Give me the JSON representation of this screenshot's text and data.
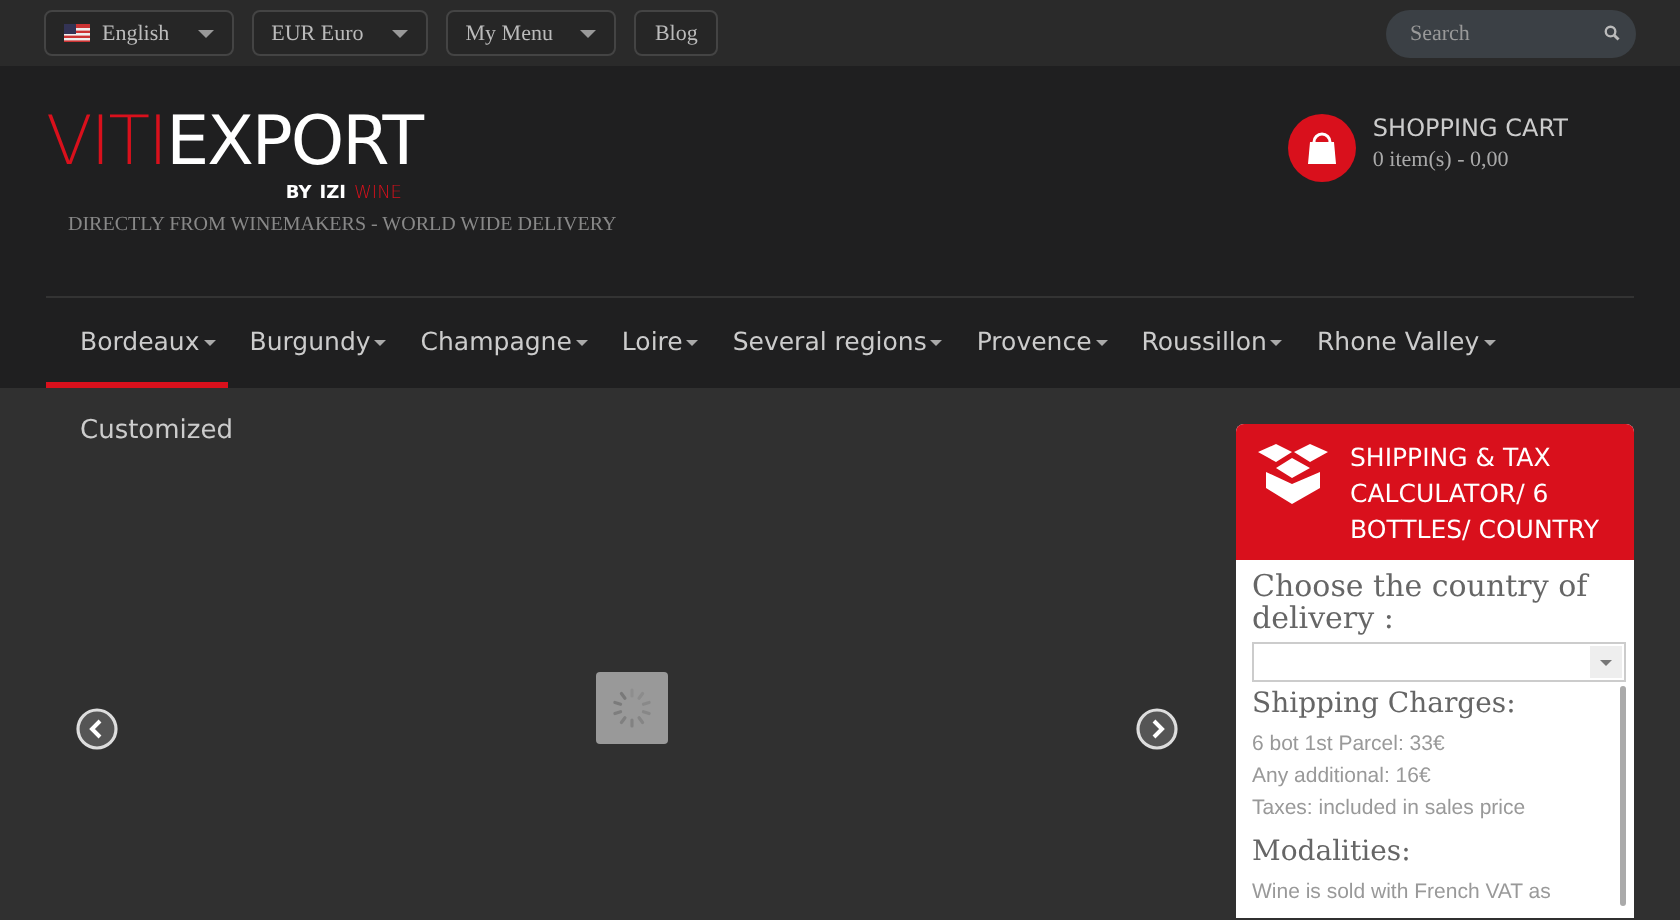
{
  "top_bar": {
    "items": [
      {
        "kind": "flag-dropdown",
        "label": "English"
      },
      {
        "kind": "dropdown",
        "label": "EUR Euro"
      },
      {
        "kind": "dropdown",
        "label": "My Menu"
      },
      {
        "kind": "link",
        "label": "Blog"
      }
    ],
    "search": {
      "placeholder": "Search"
    }
  },
  "header": {
    "logo": {
      "red_part": "VITI",
      "white_part": "EXPORT",
      "by": "BY",
      "by_plain": "IZI",
      "by_red": "WINE"
    },
    "tagline": "DIRECTLY FROM WINEMAKERS - WORLD WIDE DELIVERY",
    "cart": {
      "title": "SHOPPING CART",
      "summary": "0 item(s) - 0,00"
    }
  },
  "nav": [
    {
      "label": "Bordeaux",
      "selected": true
    },
    {
      "label": "Burgundy",
      "selected": false
    },
    {
      "label": "Champagne",
      "selected": false
    },
    {
      "label": "Loire",
      "selected": false
    },
    {
      "label": "Several regions",
      "selected": false
    },
    {
      "label": "Provence",
      "selected": false
    },
    {
      "label": "Roussillon",
      "selected": false
    },
    {
      "label": "Rhone Valley",
      "selected": false
    }
  ],
  "content": {
    "heading": "Customized"
  },
  "calculator": {
    "title": "SHIPPING & TAX CALCULATOR/ 6 BOTTLES/ COUNTRY",
    "country_label": "Choose the country of delivery :",
    "sections": [
      {
        "heading": "Shipping Charges:",
        "lines": [
          "6 bot 1st Parcel: 33€",
          "Any additional: 16€",
          "Taxes: included in sales price"
        ]
      },
      {
        "heading": "Modalities:",
        "lines": [
          "Wine is sold with French VAT as"
        ]
      }
    ]
  }
}
